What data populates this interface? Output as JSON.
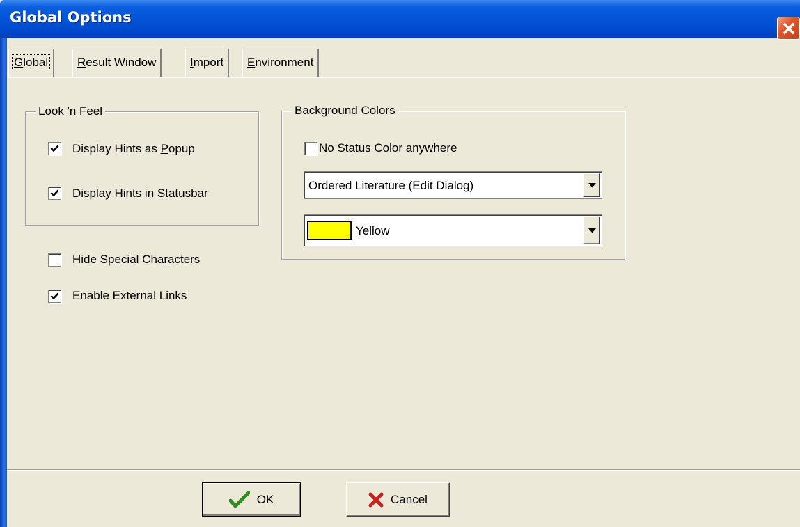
{
  "window": {
    "title": "Global Options"
  },
  "tabs": [
    {
      "label": "Global",
      "accel": "G",
      "rest": "lobal",
      "active": true
    },
    {
      "label": "Result Window",
      "accel": "R",
      "rest": "esult Window"
    },
    {
      "label": "Import",
      "accel": "I",
      "rest": "mport"
    },
    {
      "label": "Environment",
      "accel": "E",
      "rest": "nvironment"
    }
  ],
  "look_feel": {
    "legend": "Look 'n Feel",
    "hints_popup": {
      "pre": "Display Hints as ",
      "accel": "P",
      "post": "opup",
      "checked": true
    },
    "hints_statusbar": {
      "pre": "Display Hints in ",
      "accel": "S",
      "post": "tatusbar",
      "checked": true
    }
  },
  "options": {
    "hide_special": {
      "label": "Hide Special Characters",
      "checked": false
    },
    "external_links": {
      "label": "Enable External Links",
      "checked": true
    }
  },
  "background_colors": {
    "legend": "Background Colors",
    "no_status": {
      "label": "No Status Color anywhere",
      "checked": false
    },
    "target_select": {
      "value": "Ordered Literature (Edit Dialog)"
    },
    "color_select": {
      "value": "Yellow",
      "swatch": "#ffff00"
    }
  },
  "buttons": {
    "ok": "OK",
    "cancel": "Cancel"
  },
  "colors": {
    "titlebar": "#0454d8",
    "face": "#ece9d8",
    "ok_icon": "#2e8b1e",
    "cancel_icon": "#c8201a"
  }
}
